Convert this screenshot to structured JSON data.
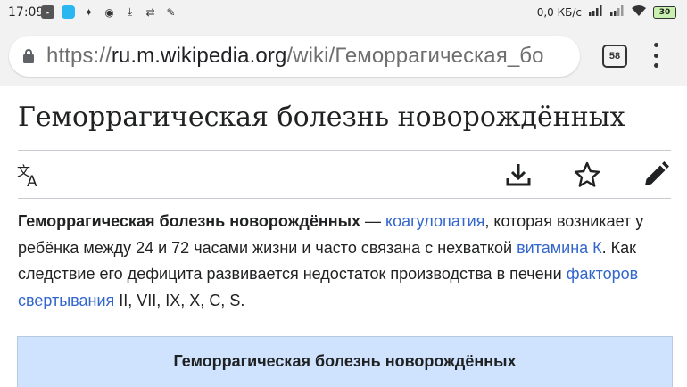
{
  "status_bar": {
    "time": "17:09",
    "network_speed": "0,0 КБ/с",
    "battery": "30",
    "icons": [
      "notification-app-icon",
      "blue-app-icon",
      "tools-icon",
      "speech-icon",
      "download-status-icon",
      "sync-icon",
      "tool-icon"
    ]
  },
  "browser": {
    "url_protocol": "https://",
    "url_host": "ru.m.wikipedia.org",
    "url_path": "/wiki/Геморрагическая_бо",
    "tab_count": "58"
  },
  "article": {
    "title": "Геморрагическая болезнь новорождённых",
    "intro": {
      "bold": "Геморрагическая болезнь новорождённых",
      "t1": " — ",
      "link1": "коагулопатия",
      "t2": ", которая возникает у ребёнка между 24 и 72 часами жизни и часто связана с нехваткой ",
      "link2": "витамина К",
      "t3": ". Как следствие его дефицита развивается недостаток производства в печени ",
      "link3": "факторов свертывания",
      "t4": " II, VII, IX, X, C, S."
    },
    "infobox_title": "Геморрагическая болезнь новорождённых"
  },
  "colors": {
    "link": "#3366cc",
    "infobox_bg": "#cfe3ff",
    "chrome_bg": "#f2f2f2"
  }
}
